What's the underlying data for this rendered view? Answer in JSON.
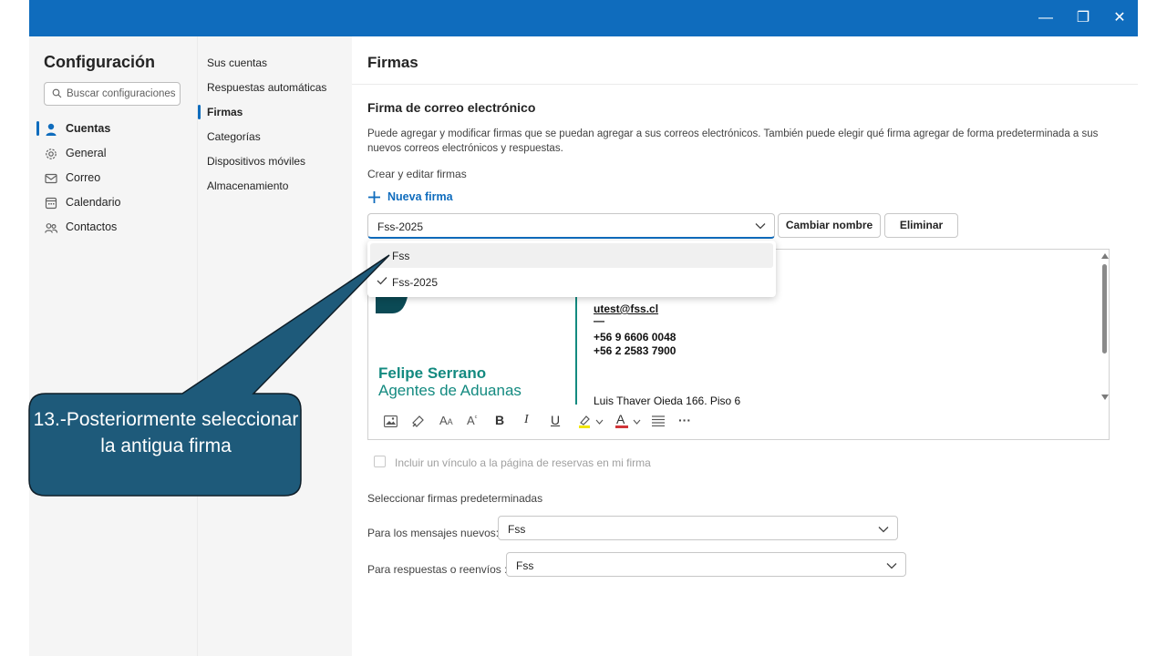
{
  "window_controls": {
    "minimize": "—",
    "restore": "❐",
    "close": "✕"
  },
  "left_nav": {
    "title": "Configuración",
    "search_placeholder": "Buscar configuraciones",
    "items": [
      {
        "label": "Cuentas",
        "icon": "person-icon",
        "selected": true
      },
      {
        "label": "General",
        "icon": "gear-icon"
      },
      {
        "label": "Correo",
        "icon": "mail-icon"
      },
      {
        "label": "Calendario",
        "icon": "calendar-icon"
      },
      {
        "label": "Contactos",
        "icon": "people-icon"
      }
    ]
  },
  "mid_nav": {
    "items": [
      {
        "label": "Sus cuentas"
      },
      {
        "label": "Respuestas automáticas"
      },
      {
        "label": "Firmas",
        "selected": true
      },
      {
        "label": "Categorías"
      },
      {
        "label": "Dispositivos móviles"
      },
      {
        "label": "Almacenamiento"
      }
    ]
  },
  "content": {
    "title": "Firmas",
    "section_title": "Firma de correo electrónico",
    "description": "Puede agregar y modificar firmas que se puedan agregar a sus correos electrónicos. También puede elegir qué firma agregar de forma predeterminada a sus nuevos correos electrónicos y respuestas.",
    "create_edit_label": "Crear y editar firmas",
    "new_signature": "Nueva firma",
    "selected_signature": "Fss-2025",
    "rename_button": "Cambiar nombre",
    "delete_button": "Eliminar",
    "dropdown_options": [
      {
        "label": "Fss",
        "hover": true
      },
      {
        "label": "Fss-2025",
        "checked": true
      }
    ],
    "signature_preview": {
      "email": "utest@fss.cl",
      "dash": "—",
      "phone1": "+56 9 6606 0048",
      "phone2": "+56 2 2583 7900",
      "name": "Felipe Serrano",
      "company": "Agentes de Aduanas",
      "address": "Luis Thayer Ojeda 166, Piso 6"
    },
    "toolbar_icons": [
      "image-icon",
      "format-painter-icon",
      "font-size-icon",
      "superscript-icon",
      "bold-icon",
      "italic-icon",
      "underline-icon",
      "highlight-icon",
      "chevron-down-icon",
      "font-color-icon",
      "chevron-down-icon",
      "list-icon",
      "more-icon"
    ],
    "toolbar_glyphs": {
      "bold": "B",
      "italic": "I",
      "underline": "U",
      "font_size": "A",
      "superscript": "A",
      "font_color": "A",
      "more": "···"
    },
    "booking_checkbox_label": "Incluir un vínculo a la página de reservas en mi firma",
    "default_signatures_label": "Seleccionar firmas predeterminadas",
    "new_messages_label": "Para los mensajes nuevos:",
    "new_messages_value": "Fss",
    "replies_label": "Para respuestas o reenvíos :",
    "replies_value": "Fss"
  },
  "callout": {
    "text": "13.-Posteriormente seleccionar la antigua firma",
    "fill_color": "#1e5a7a"
  },
  "colors": {
    "titlebar": "#0f6cbd",
    "accent": "#0f6cbd",
    "brand_teal": "#138a80",
    "brand_dark": "#0b4a55"
  }
}
